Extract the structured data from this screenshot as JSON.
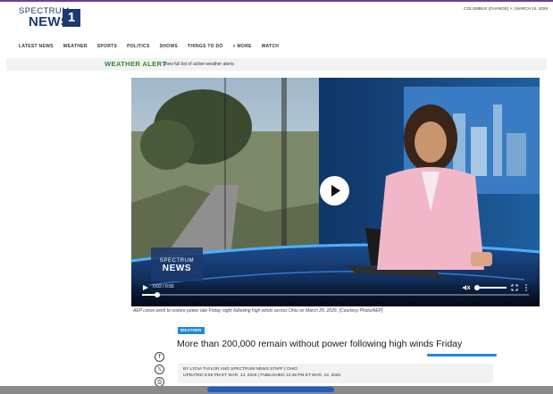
{
  "brand": {
    "logo_top": "SPECTRUM",
    "logo_bottom": "NEWS",
    "logo_number": "1",
    "accent_color": "#1c3a6e",
    "top_rule_color": "#6b3fa0"
  },
  "header": {
    "region_text": "COLUMBUS (CHANGE)  >  |  MARCH 14, 2026"
  },
  "nav": {
    "items": [
      {
        "label": "LATEST NEWS"
      },
      {
        "label": "WEATHER"
      },
      {
        "label": "SPORTS"
      },
      {
        "label": "POLITICS"
      },
      {
        "label": "SHOWS"
      },
      {
        "label": "THINGS TO DO"
      },
      {
        "label": "+ MORE"
      },
      {
        "label": "WATCH"
      }
    ]
  },
  "alert": {
    "label": "WEATHER ALERT",
    "text": "View full list of active weather alerts",
    "color": "#2e8540"
  },
  "video": {
    "time": "0:02 / 0:55",
    "watermark_top": "SPECTRUM",
    "watermark_bottom": "NEWS",
    "play_icon": "play-icon",
    "mute_icon": "mute-icon",
    "fullscreen_icon": "fullscreen-icon",
    "menu_icon": "more-vertical-icon",
    "progress": 0.04
  },
  "article": {
    "caption": "AEP crews work to restore power late Friday night following high winds across Ohio on March 25, 2026. (Courtesy Photo/AEP)",
    "category": "WEATHER",
    "headline": "More than 200,000 remain without power following high winds Friday",
    "byline": "BY LYDIA TAYLOR AND SPECTRUM NEWS STAFF | OHIO",
    "updated": "UPDATED 5:58 PM ET MAR. 14, 2026 | PUBLISHED 12:46 PM ET MAR. 13, 2026",
    "tag_color": "#1f88d9"
  },
  "social": [
    {
      "icon": "facebook-icon",
      "glyph": "f"
    },
    {
      "icon": "x-icon",
      "glyph": "𝕏"
    },
    {
      "icon": "share-icon",
      "glyph": "⎙"
    }
  ]
}
